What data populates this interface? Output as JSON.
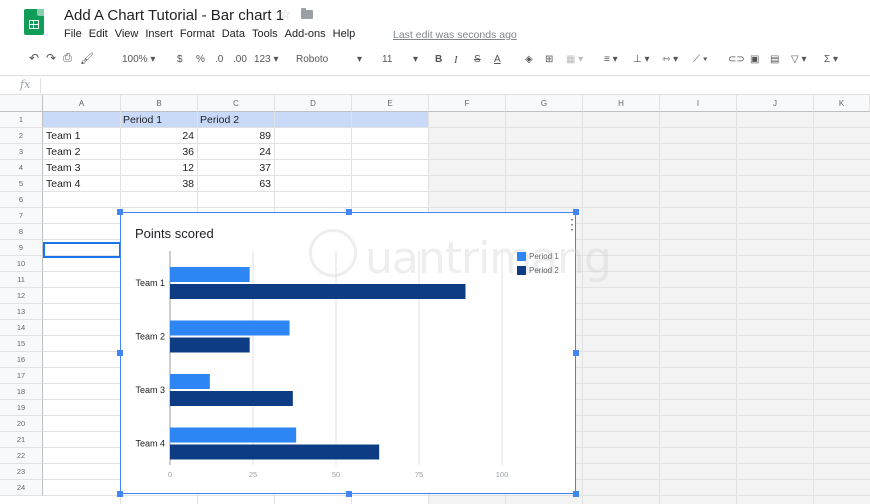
{
  "doc": {
    "title": "Add A Chart Tutorial - Bar chart 1",
    "last_edit": "Last edit was seconds ago"
  },
  "menu": [
    "File",
    "Edit",
    "View",
    "Insert",
    "Format",
    "Data",
    "Tools",
    "Add-ons",
    "Help"
  ],
  "toolbar": {
    "undo_icon": "undo-icon",
    "redo_icon": "redo-icon",
    "print_icon": "print-icon",
    "paint_format_icon": "paint-format-icon",
    "zoom": "100%",
    "currency": "$",
    "percent": "%",
    "decrease_decimal": ".0",
    "increase_decimal": ".00",
    "more_formats": "123",
    "font": "Roboto",
    "font_size": "11",
    "bold": "B",
    "italic": "I",
    "strikethrough": "S",
    "text_color": "A",
    "sum": "Σ"
  },
  "formula_bar": {
    "fx": "fx"
  },
  "columns": [
    "A",
    "B",
    "C",
    "D",
    "E",
    "F",
    "G",
    "H",
    "I",
    "J",
    "K"
  ],
  "rows": [
    "1",
    "2",
    "3",
    "4",
    "5",
    "6",
    "7",
    "8",
    "9",
    "10",
    "11",
    "12",
    "13",
    "14",
    "15",
    "16",
    "17",
    "18",
    "19",
    "20",
    "21",
    "22",
    "23",
    "24"
  ],
  "cells": {
    "B1": "Period 1",
    "C1": "Period 2",
    "A2": "Team 1",
    "B2": "24",
    "C2": "89",
    "A3": "Team 2",
    "B3": "36",
    "C3": "24",
    "A4": "Team 3",
    "B4": "12",
    "C4": "37",
    "A5": "Team 4",
    "B5": "38",
    "C5": "63"
  },
  "colors": {
    "period1": "#2e86f5",
    "period2": "#0d3c84",
    "selection": "#4285f4",
    "header_row_fill": "#c9daf8",
    "sheets_green": "#0f9d58"
  },
  "chart_data": {
    "type": "bar",
    "orientation": "horizontal",
    "title": "Points scored",
    "categories": [
      "Team 1",
      "Team 2",
      "Team 3",
      "Team 4"
    ],
    "series": [
      {
        "name": "Period 1",
        "values": [
          24,
          36,
          12,
          38
        ]
      },
      {
        "name": "Period 2",
        "values": [
          89,
          24,
          37,
          63
        ]
      }
    ],
    "xticks": [
      "0",
      "25",
      "50",
      "75",
      "100"
    ],
    "xlim": [
      0,
      100
    ],
    "grid": true,
    "legend_position": "top-right"
  }
}
